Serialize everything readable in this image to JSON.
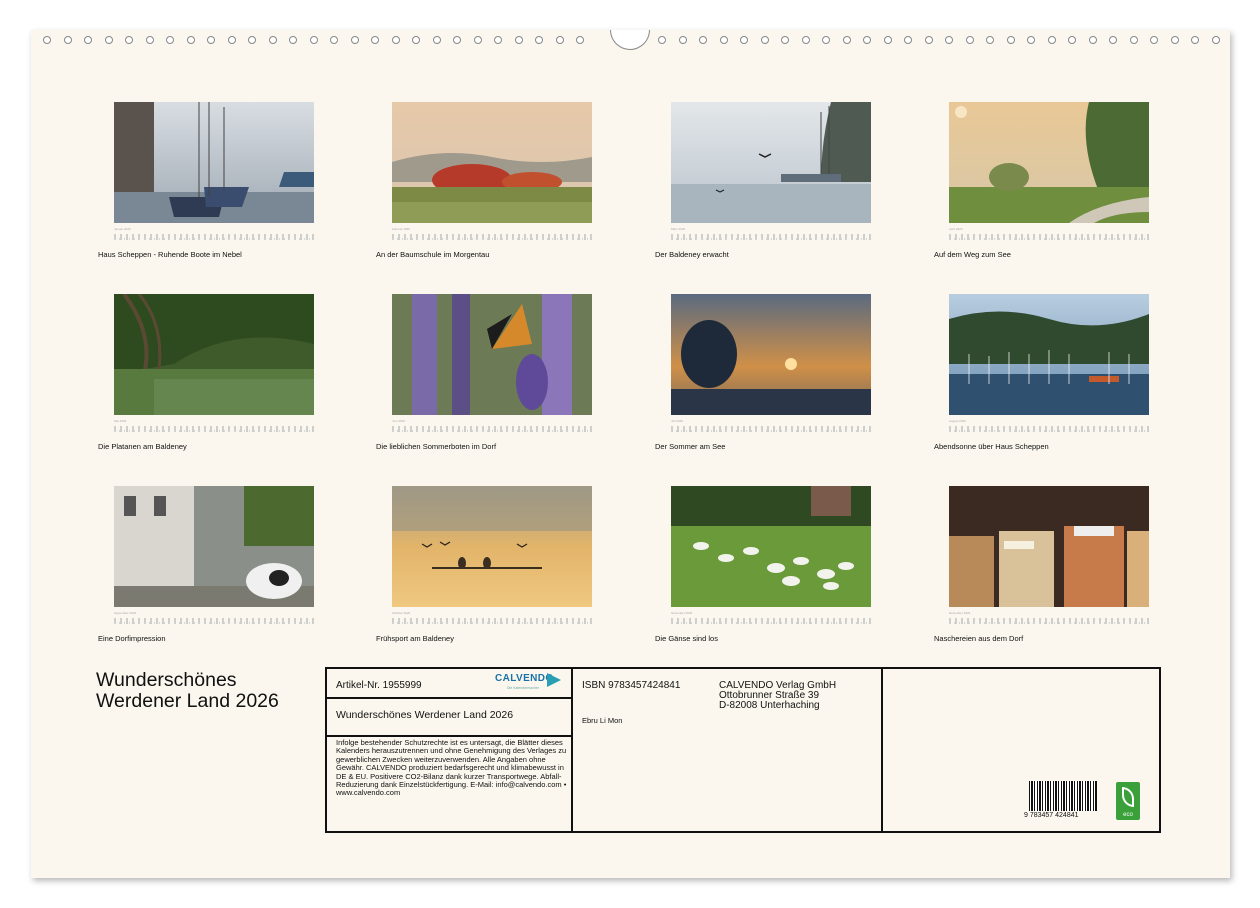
{
  "months": [
    {
      "month_label": "Januar 2026",
      "caption": "Haus Scheppen - Ruhende Boote im Nebel"
    },
    {
      "month_label": "Februar 2026",
      "caption": "An der Baumschule im Morgentau"
    },
    {
      "month_label": "März 2026",
      "caption": "Der Baldeney erwacht"
    },
    {
      "month_label": "April 2026",
      "caption": "Auf dem Weg zum See"
    },
    {
      "month_label": "Mai 2026",
      "caption": "Die Platanen am Baldeney"
    },
    {
      "month_label": "Juni 2026",
      "caption": "Die lieblichen Sommerboten im Dorf"
    },
    {
      "month_label": "Juli 2026",
      "caption": "Der Sommer am See"
    },
    {
      "month_label": "August 2026",
      "caption": "Abendsonne über Haus Scheppen"
    },
    {
      "month_label": "September 2026",
      "caption": "Eine Dorfimpression"
    },
    {
      "month_label": "Oktober 2026",
      "caption": "Frühsport am Baldeney"
    },
    {
      "month_label": "November 2026",
      "caption": "Die Gänse sind los"
    },
    {
      "month_label": "Dezember 2026",
      "caption": "Naschereien aus dem Dorf"
    }
  ],
  "title_line1": "Wunderschönes",
  "title_line2": "Werdener Land 2026",
  "info": {
    "article": "Artikel-Nr. 1955999",
    "brand": "CALVENDO",
    "brand_sub": "Die Kalendermacher",
    "calendar_title": "Wunderschönes Werdener Land 2026",
    "legal": "Infolge bestehender Schutzrechte ist es untersagt, die Blätter dieses Kalenders herauszutrennen und ohne Genehmigung des Verlages zu gewerblichen Zwecken weiterzuverwenden. Alle Angaben ohne Gewähr. CALVENDO produziert bedarfsgerecht und klimabewusst in DE & EU. Positivere CO2-Bilanz dank kurzer Transportwege. Abfall-Reduzierung dank Einzelstückfertigung. E-Mail: info@calvendo.com • www.calvendo.com",
    "isbn": "ISBN 9783457424841",
    "author": "Ebru Li Mon",
    "publisher_line1": "CALVENDO Verlag GmbH",
    "publisher_line2": "Ottobrunner Straße 39",
    "publisher_line3": "D-82008 Unterhaching",
    "barcode_number": "9 783457 424841",
    "eco_label": "eco"
  }
}
